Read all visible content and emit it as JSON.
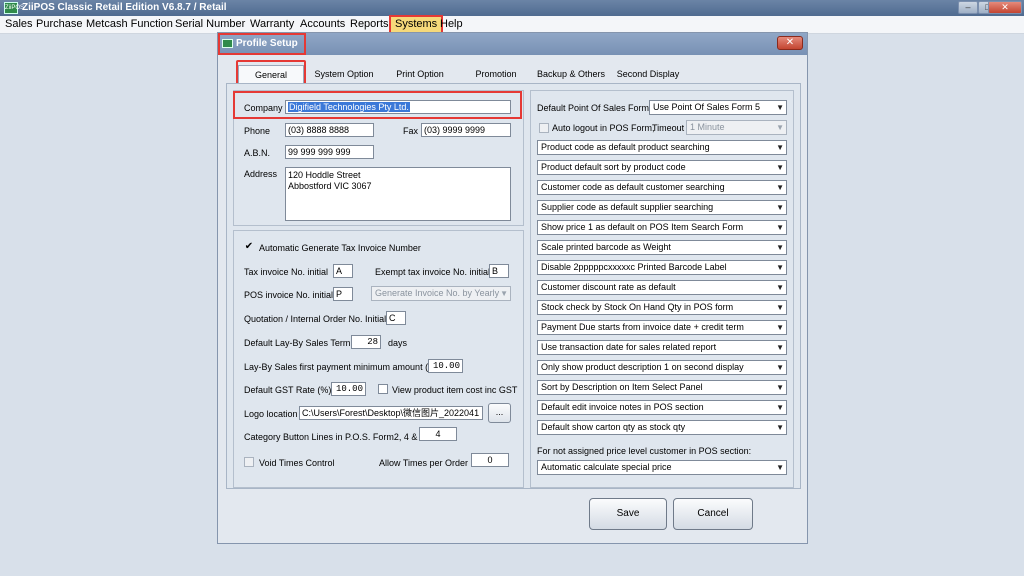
{
  "app": {
    "title": "ZiiPOS Classic Retail Edition V6.8.7 / Retail",
    "menu": [
      "Sales",
      "Purchase",
      "Metcash Function",
      "Serial Number",
      "Warranty",
      "Accounts",
      "Reports",
      "Systems",
      "Help"
    ],
    "active_menu": "Systems"
  },
  "dialog": {
    "title": "Profile Setup",
    "tabs": [
      "General",
      "System Option",
      "Print Option",
      "Promotion",
      "Backup & Others",
      "Second Display"
    ],
    "active_tab": "General"
  },
  "company": {
    "company_label": "Company",
    "company_value": "Digifield Technologies Pty Ltd.",
    "phone_label": "Phone",
    "phone_value": "(03) 8888 8888",
    "fax_label": "Fax",
    "fax_value": "(03) 9999 9999",
    "abn_label": "A.B.N.",
    "abn_value": "99 999 999 999",
    "address_label": "Address",
    "address_line1": "120 Hoddle Street",
    "address_line2": "Abbostford VIC 3067"
  },
  "invoice": {
    "auto_tax_label": "Automatic Generate Tax Invoice Number",
    "tax_initial_label": "Tax invoice No. initial",
    "tax_initial_value": "A",
    "exempt_initial_label": "Exempt tax invoice No. initial",
    "exempt_initial_value": "B",
    "pos_initial_label": "POS invoice No. initial",
    "pos_initial_value": "P",
    "generate_by_value": "Generate Invoice No. by Yearly",
    "quotation_label": "Quotation / Internal Order No. Initial",
    "quotation_value": "C",
    "layby_term_label": "Default Lay-By Sales Term",
    "layby_term_value": "28",
    "layby_term_unit": "days",
    "layby_min_label": "Lay-By Sales first payment minimum amount (%)",
    "layby_min_value": "10.00",
    "gst_label": "Default GST Rate (%)",
    "gst_value": "10.00",
    "view_cost_label": "View product item cost inc GST",
    "logo_label": "Logo location",
    "logo_value": "C:\\Users\\Forest\\Desktop\\微信图片_2022041",
    "browse_label": "...",
    "category_lines_label": "Category Button Lines in P.O.S. Form2, 4 & 7",
    "category_lines_value": "4",
    "void_label": "Void Times Control",
    "allow_times_label": "Allow Times per Order",
    "allow_times_value": "0"
  },
  "right": {
    "pos_form_label": "Default Point Of Sales Form",
    "pos_form_value": "Use Point Of Sales Form 5",
    "auto_logout_label": "Auto logout in POS Form,",
    "timeout_label": "Timeout",
    "timeout_value": "1  Minute",
    "options": [
      "Product code as default product searching",
      "Product default sort by product code",
      "Customer code as default customer searching",
      "Supplier code as default supplier searching",
      "Show price 1 as default on POS Item Search Form",
      "Scale printed barcode as Weight",
      "Disable 2pppppcxxxxxc Printed Barcode Label",
      "Customer discount rate as default",
      "Stock check by Stock On Hand Qty in POS form",
      "Payment Due starts from invoice date + credit term",
      "Use transaction date for sales related report",
      "Only show product description 1 on second display",
      "Sort by Description on Item Select Panel",
      "Default edit invoice notes in POS section",
      "Default show carton qty as stock qty"
    ],
    "price_level_label": "For not assigned price level customer in POS section:",
    "price_level_value": "Automatic calculate special price"
  },
  "buttons": {
    "save": "Save",
    "cancel": "Cancel"
  },
  "icons": {
    "dropdown": "chevron-down-icon",
    "check": "check-icon",
    "close": "close-icon"
  }
}
